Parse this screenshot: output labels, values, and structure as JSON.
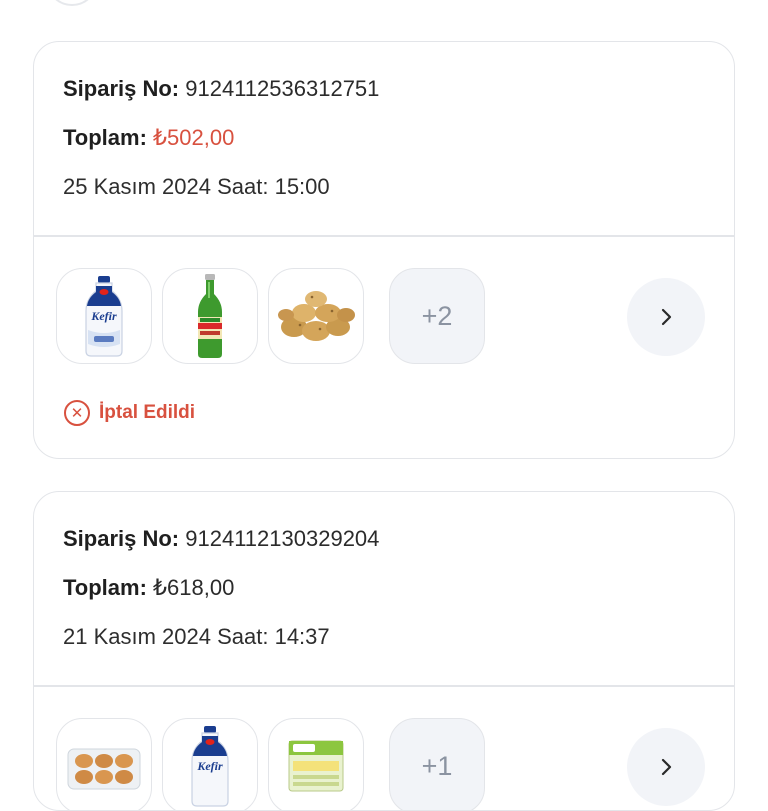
{
  "orders": [
    {
      "order_no_label": "Sipariş No:",
      "order_no": "9124112536312751",
      "total_label": "Toplam:",
      "total": "₺502,00",
      "date": "25 Kasım 2024 Saat: 15:00",
      "products": [
        {
          "icon": "kefir-bottle-icon"
        },
        {
          "icon": "soda-bottle-icon"
        },
        {
          "icon": "potatoes-icon"
        }
      ],
      "more_count": "+2",
      "status": "İptal Edildi",
      "status_color": "#d8513f"
    },
    {
      "order_no_label": "Sipariş No:",
      "order_no": "9124112130329204",
      "total_label": "Toplam:",
      "total": "₺618,00",
      "date": "21 Kasım 2024 Saat: 14:37",
      "products": [
        {
          "icon": "eggs-icon"
        },
        {
          "icon": "kefir-bottle-icon"
        },
        {
          "icon": "product-box-icon"
        }
      ],
      "more_count": "+1"
    }
  ],
  "colors": {
    "accent_red": "#d8513f",
    "border": "#e3e5e9",
    "chip_bg": "#f2f4f8"
  }
}
